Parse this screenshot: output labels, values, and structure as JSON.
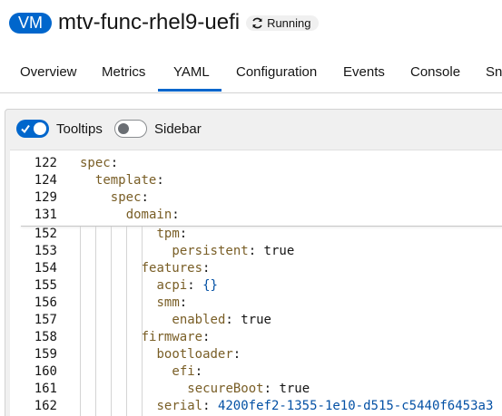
{
  "header": {
    "badge": "VM",
    "name": "mtv-func-rhel9-uefi",
    "status": "Running",
    "status_icon": "sync-icon"
  },
  "tabs": [
    {
      "label": "Overview"
    },
    {
      "label": "Metrics"
    },
    {
      "label": "YAML",
      "active": true
    },
    {
      "label": "Configuration"
    },
    {
      "label": "Events"
    },
    {
      "label": "Console"
    },
    {
      "label": "Sn"
    }
  ],
  "toolbar": {
    "tooltips_label": "Tooltips",
    "tooltips_on": true,
    "sidebar_label": "Sidebar",
    "sidebar_on": false
  },
  "editor": {
    "sticky": [
      {
        "num": "122",
        "indent": 0,
        "key": "spec",
        "value": ""
      },
      {
        "num": "124",
        "indent": 1,
        "key": "template",
        "value": ""
      },
      {
        "num": "129",
        "indent": 2,
        "key": "spec",
        "value": ""
      },
      {
        "num": "131",
        "indent": 3,
        "key": "domain",
        "value": ""
      }
    ],
    "lines": [
      {
        "num": "152",
        "indent": 5,
        "key": "tpm",
        "value": ""
      },
      {
        "num": "153",
        "indent": 6,
        "key": "persistent",
        "value": "true"
      },
      {
        "num": "154",
        "indent": 4,
        "key": "features",
        "value": ""
      },
      {
        "num": "155",
        "indent": 5,
        "key": "acpi",
        "value": "{}"
      },
      {
        "num": "156",
        "indent": 5,
        "key": "smm",
        "value": ""
      },
      {
        "num": "157",
        "indent": 6,
        "key": "enabled",
        "value": "true"
      },
      {
        "num": "158",
        "indent": 4,
        "key": "firmware",
        "value": ""
      },
      {
        "num": "159",
        "indent": 5,
        "key": "bootloader",
        "value": ""
      },
      {
        "num": "160",
        "indent": 6,
        "key": "efi",
        "value": ""
      },
      {
        "num": "161",
        "indent": 7,
        "key": "secureBoot",
        "value": "true"
      },
      {
        "num": "162",
        "indent": 5,
        "key": "serial",
        "value": "4200fef2-1355-1e10-d515-c5440f6453a3"
      }
    ]
  },
  "colors": {
    "accent": "#0066cc",
    "yaml_key": "#795e26",
    "yaml_string": "#0451a5"
  }
}
